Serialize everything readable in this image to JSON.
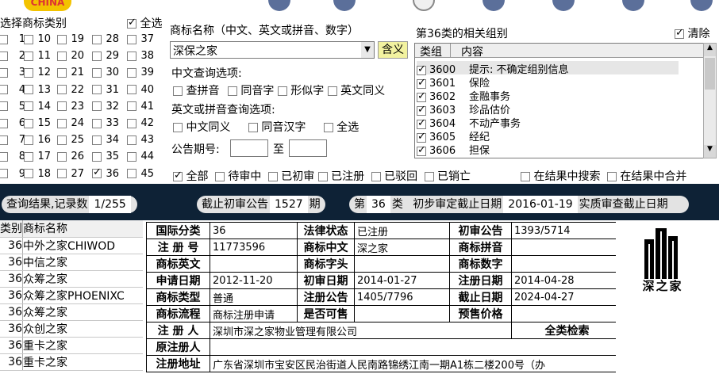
{
  "toolbar": {
    "logo_text": "CHINA"
  },
  "class_panel": {
    "title": "选择商标类别",
    "select_all_label": "全选",
    "columns": [
      [
        "1",
        "2",
        "3",
        "4",
        "5",
        "6",
        "7",
        "8",
        "9"
      ],
      [
        "10",
        "11",
        "12",
        "13",
        "14",
        "15",
        "16",
        "17",
        "18"
      ],
      [
        "19",
        "20",
        "21",
        "22",
        "23",
        "24",
        "25",
        "26",
        "27"
      ],
      [
        "28",
        "29",
        "30",
        "31",
        "32",
        "33",
        "34",
        "35",
        "36"
      ],
      [
        "37",
        "38",
        "39",
        "40",
        "41",
        "42",
        "43",
        "44",
        "45"
      ]
    ],
    "checked": [
      "36"
    ]
  },
  "search": {
    "name_label": "商标名称（中文、英文或拼音、数字）",
    "name_value": "深保之家",
    "meaning_button": "含义",
    "cn_options_label": "中文查询选项:",
    "cn_options": [
      "查拼音",
      "同音字",
      "形似字",
      "英文同义"
    ],
    "en_options_label": "英文或拼音查询选项:",
    "en_options": [
      "中文同义",
      "同音汉字",
      "全选"
    ],
    "issue_label": "公告期号:",
    "issue_to": "至",
    "status_options": [
      "全部",
      "待审中",
      "已初审",
      "已注册",
      "已驳回",
      "已销亡"
    ],
    "result_options": [
      "在结果中搜索",
      "在结果中合并"
    ]
  },
  "groups": {
    "title": "第36类的相关组别",
    "clear_label": "清除",
    "col_group": "类组",
    "col_content": "内容",
    "rows": [
      {
        "code": "3600",
        "text": "提示: 不确定组别信息"
      },
      {
        "code": "3601",
        "text": "保险"
      },
      {
        "code": "3602",
        "text": "金融事务"
      },
      {
        "code": "3603",
        "text": "珍品估价"
      },
      {
        "code": "3604",
        "text": "不动产事务"
      },
      {
        "code": "3605",
        "text": "经纪"
      },
      {
        "code": "3606",
        "text": "担保"
      }
    ]
  },
  "status_bar": {
    "result_label": "查询结果,记录数",
    "result_count": "1/255",
    "deadline_label": "截止初审公告",
    "deadline_value": "1527",
    "period_label": "期",
    "class_prefix": "第",
    "class_value": "36",
    "class_suffix": "类",
    "prelim_label": "初步审定截止日期",
    "prelim_value": "2016-01-19",
    "substantive_label": "实质审查截止日期"
  },
  "list": {
    "col_class": "类别",
    "col_name": "商标名称",
    "rows": [
      {
        "cls": "36",
        "name": "中外之家CHIWOD"
      },
      {
        "cls": "36",
        "name": "中信之家"
      },
      {
        "cls": "36",
        "name": "众筹之家"
      },
      {
        "cls": "36",
        "name": "众筹之家PHOENIXC"
      },
      {
        "cls": "36",
        "name": "众筹之家"
      },
      {
        "cls": "36",
        "name": "众创之家"
      },
      {
        "cls": "36",
        "name": "重卡之家"
      },
      {
        "cls": "36",
        "name": "重卡之家"
      }
    ]
  },
  "detail": {
    "intl_class_label": "国际分类",
    "intl_class": "36",
    "legal_status_label": "法律状态",
    "legal_status": "已注册",
    "prelim_notice_label": "初审公告",
    "prelim_notice": "1393/5714",
    "reg_no_label": "注 册 号",
    "reg_no": "11773596",
    "name_cn_label": "商标中文",
    "name_cn": "深之家",
    "pinyin_label": "商标拼音",
    "pinyin": "",
    "name_en_label": "商标英文",
    "name_en": "",
    "initial_label": "商标字头",
    "initial": "",
    "digits_label": "商标数字",
    "digits": "",
    "apply_date_label": "申请日期",
    "apply_date": "2012-11-20",
    "prelim_date_label": "初审日期",
    "prelim_date": "2014-01-27",
    "reg_date_label": "注册日期",
    "reg_date": "2014-04-28",
    "type_label": "商标类型",
    "type": "普通",
    "reg_notice_label": "注册公告",
    "reg_notice": "1405/7796",
    "expiry_label": "截止日期",
    "expiry": "2024-04-27",
    "process_label": "商标流程",
    "process": "商标注册申请",
    "sale_label": "是否可售",
    "sale": "",
    "price_label": "预售价格",
    "price": "",
    "registrant_label": "注 册 人",
    "registrant": "深圳市深之家物业管理有限公司",
    "all_class_search": "全类检索",
    "orig_registrant_label": "原注册人",
    "orig_registrant": "",
    "address_label": "注册地址",
    "address": "广东省深圳市宝安区民治街道人民南路锦绣江南一期A1栋二楼200号（办"
  },
  "logo": {
    "text": "深之家"
  }
}
